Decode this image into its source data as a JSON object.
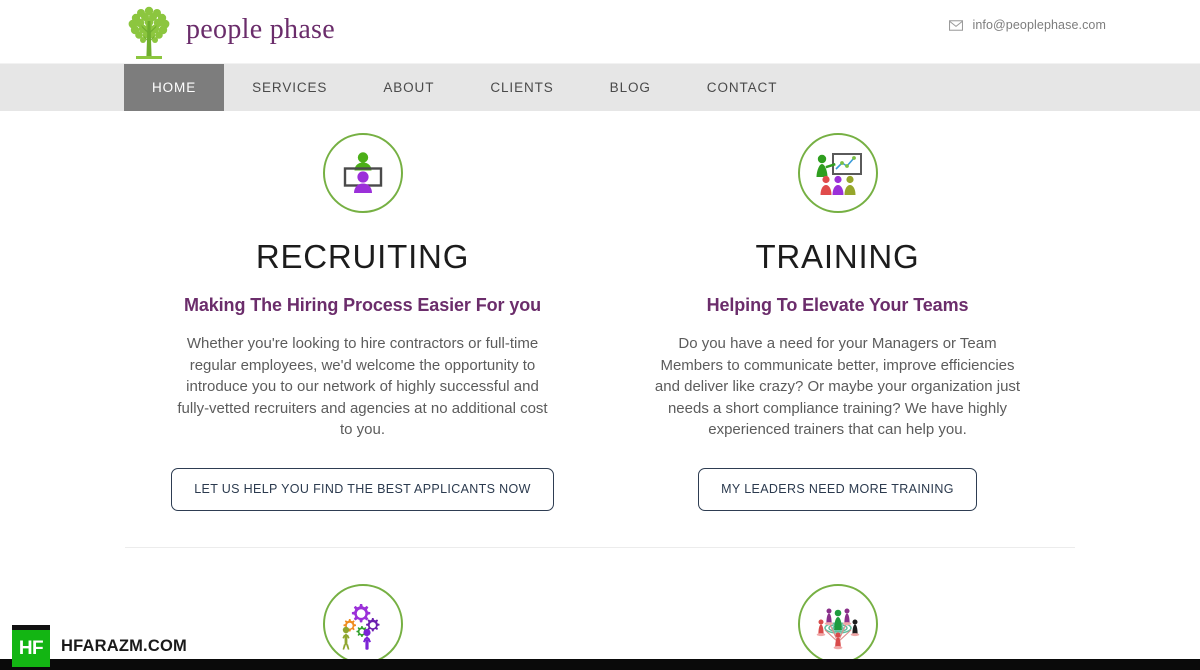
{
  "header": {
    "brand_name": "people phase",
    "logo_icon": "tree-icon",
    "mail_icon": "envelope-icon",
    "email": "info@peoplephase.com"
  },
  "nav": {
    "items": [
      {
        "label": "HOME",
        "active": true
      },
      {
        "label": "SERVICES",
        "active": false
      },
      {
        "label": "ABOUT",
        "active": false
      },
      {
        "label": "CLIENTS",
        "active": false
      },
      {
        "label": "BLOG",
        "active": false
      },
      {
        "label": "CONTACT",
        "active": false
      }
    ]
  },
  "cards": [
    {
      "icon": "presentation-desk-person-icon",
      "title": "RECRUITING",
      "subtitle": "Making The Hiring Process Easier For you",
      "body": "Whether you're looking to hire contractors or full-time regular employees, we'd welcome the opportunity to introduce you to our network of highly successful and fully-vetted recruiters and agencies at no additional cost to you.",
      "cta": "LET US HELP YOU FIND THE BEST APPLICANTS NOW"
    },
    {
      "icon": "trainer-whiteboard-audience-icon",
      "title": "TRAINING",
      "subtitle": "Helping To Elevate Your Teams",
      "body": "Do you have a need for your Managers or Team Members to communicate better, improve efficiencies and deliver like crazy? Or maybe your organization just needs a short compliance training? We have highly experienced trainers that can help you.",
      "cta": "MY LEADERS NEED MORE TRAINING"
    }
  ],
  "cards_row2": [
    {
      "icon": "people-gears-icon"
    },
    {
      "icon": "team-network-icon"
    }
  ],
  "watermark": {
    "badge": "HF",
    "text": "HFARAZM.COM"
  },
  "colors": {
    "brand_purple": "#6b2d6b",
    "icon_green": "#76b043",
    "nav_background": "#e6e6e6",
    "nav_active": "#7d7d7d",
    "button_border": "#2e3d52",
    "watermark_green": "#13b513"
  }
}
